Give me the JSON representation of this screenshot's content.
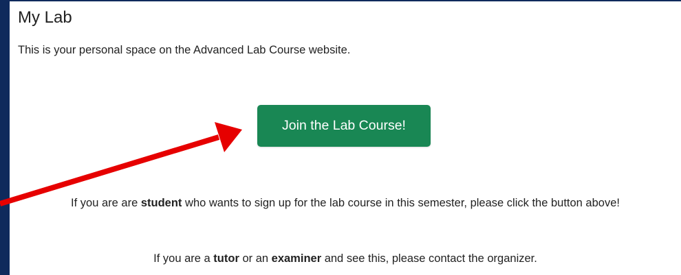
{
  "header": {
    "title": "My Lab"
  },
  "main": {
    "intro": "This is your personal space on the Advanced Lab Course website.",
    "join_button_label": "Join the Lab Course!",
    "student_note": {
      "before": "If you are are ",
      "emphasis": "student",
      "after": " who wants to sign up for the lab course in this semester, please click the button above!"
    },
    "staff_note": {
      "before": "If you are a ",
      "emphasis1": "tutor",
      "middle": " or an ",
      "emphasis2": "examiner",
      "after": " and see this, please contact the organizer."
    }
  },
  "colors": {
    "frame": "#0f2a5c",
    "button": "#198754",
    "annotation_arrow": "#e60000"
  }
}
